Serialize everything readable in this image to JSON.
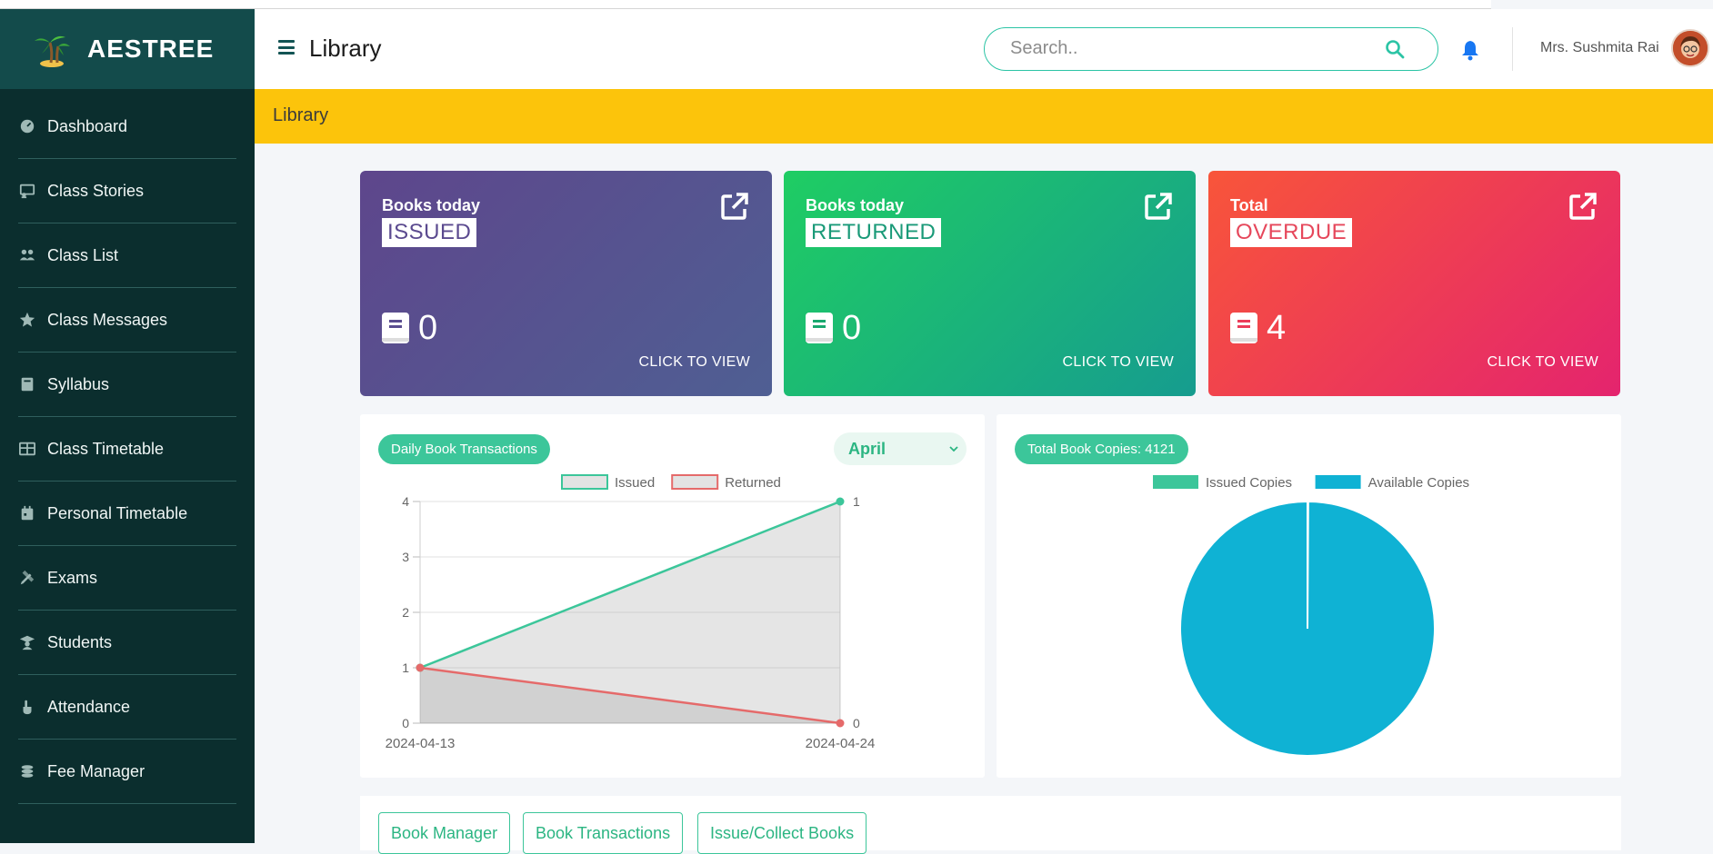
{
  "brand": {
    "name": "AESTREE"
  },
  "sidebar": {
    "items": [
      {
        "label": "Dashboard",
        "icon": "dashboard-gauge-icon"
      },
      {
        "label": "Class Stories",
        "icon": "chalkboard-icon"
      },
      {
        "label": "Class List",
        "icon": "users-icon"
      },
      {
        "label": "Class Messages",
        "icon": "star-icon"
      },
      {
        "label": "Syllabus",
        "icon": "book-icon"
      },
      {
        "label": "Class Timetable",
        "icon": "table-icon"
      },
      {
        "label": "Personal Timetable",
        "icon": "calendar-icon"
      },
      {
        "label": "Exams",
        "icon": "pencil-ruler-icon"
      },
      {
        "label": "Students",
        "icon": "graduate-icon"
      },
      {
        "label": "Attendance",
        "icon": "hand-raise-icon"
      },
      {
        "label": "Fee Manager",
        "icon": "coins-icon"
      }
    ]
  },
  "header": {
    "title": "Library",
    "search_placeholder": "Search..",
    "user_name": "Mrs. Sushmita Rai"
  },
  "banner": {
    "title": "Library"
  },
  "cards": [
    {
      "label1": "Books today",
      "label2": "ISSUED",
      "count": "0",
      "cta": "CLICK TO VIEW"
    },
    {
      "label1": "Books today",
      "label2": "RETURNED",
      "count": "0",
      "cta": "CLICK TO VIEW"
    },
    {
      "label1": "Total",
      "label2": "OVERDUE",
      "count": "4",
      "cta": "CLICK TO VIEW"
    }
  ],
  "transactions_panel": {
    "pill": "Daily Book Transactions",
    "month": "April"
  },
  "copies_panel": {
    "pill": "Total Book Copies: 4121"
  },
  "chart_data": [
    {
      "type": "line",
      "x": [
        "2024-04-13",
        "2024-04-24"
      ],
      "series": [
        {
          "name": "Issued",
          "values": [
            1,
            4
          ],
          "point_labels": [
            "",
            "1"
          ],
          "color": "#3cc69a"
        },
        {
          "name": "Returned",
          "values": [
            1,
            0
          ],
          "point_labels": [
            "",
            "0"
          ],
          "color": "#e56a6a"
        }
      ],
      "ylim": [
        0,
        4
      ],
      "yticks": [
        0,
        1,
        2,
        3,
        4
      ],
      "legend": "top-center",
      "grid": true
    },
    {
      "type": "pie",
      "labels": [
        "Issued Copies",
        "Available Copies"
      ],
      "values": [
        4,
        4117
      ],
      "colors": [
        "#3cc69a",
        "#0fb2d4"
      ],
      "legend": "top-center"
    }
  ],
  "bottom_tabs": [
    {
      "label": "Book Manager"
    },
    {
      "label": "Book Transactions"
    },
    {
      "label": "Issue/Collect Books"
    }
  ]
}
